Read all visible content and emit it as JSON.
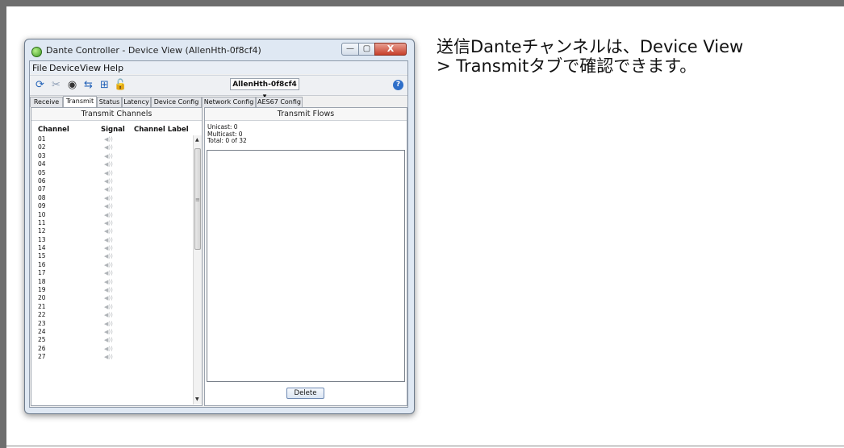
{
  "caption": {
    "line1": "送信Danteチャンネルは、Device View",
    "line2": "> Transmitタブで確認できます。"
  },
  "window": {
    "title": "Dante Controller - Device View (AllenHth-0f8cf4)",
    "controls": {
      "minimize": "—",
      "maximize": "▢",
      "close": "X"
    }
  },
  "menu": [
    "File",
    "Device",
    "View",
    "Help"
  ],
  "toolbar": {
    "icons": [
      "refresh-icon",
      "disconnect-icon",
      "eye-icon",
      "route-icon",
      "grid-icon",
      "lock-icon"
    ],
    "device_select": "AllenHth-0f8cf4 ▾",
    "help": "?"
  },
  "tabs": [
    "Receive",
    "Transmit",
    "Status",
    "Latency",
    "Device Config",
    "Network Config",
    "AES67 Config"
  ],
  "active_tab": "Transmit",
  "transmit_channels": {
    "title": "Transmit Channels",
    "headers": {
      "channel": "Channel",
      "signal": "Signal",
      "label": "Channel Label"
    },
    "signal_glyph": "◀))",
    "channels": [
      "01",
      "02",
      "03",
      "04",
      "05",
      "06",
      "07",
      "08",
      "09",
      "10",
      "11",
      "12",
      "13",
      "14",
      "15",
      "16",
      "17",
      "18",
      "19",
      "20",
      "21",
      "22",
      "23",
      "24",
      "25",
      "26",
      "27"
    ]
  },
  "transmit_flows": {
    "title": "Transmit Flows",
    "unicast": "Unicast:  0",
    "multicast": "Multicast: 0",
    "total": "Total:     0 of 32",
    "delete_label": "Delete"
  },
  "colors": {
    "border": "#6e6e6e",
    "close_button": "#c7402b",
    "accent": "#2f6fc9"
  }
}
